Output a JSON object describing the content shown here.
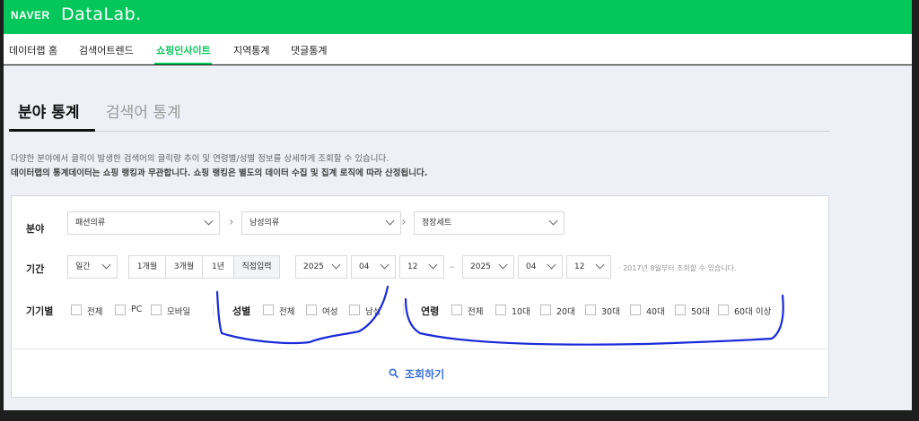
{
  "header": {
    "brand_naver": "NAVER",
    "brand_datalab": "DataLab.",
    "nav": [
      {
        "label": "데이터랩 홈"
      },
      {
        "label": "검색어트렌드"
      },
      {
        "label": "쇼핑인사이트",
        "active": true
      },
      {
        "label": "지역통계"
      },
      {
        "label": "댓글통계"
      }
    ]
  },
  "tabs": {
    "field": "분야 통계",
    "search": "검색어 통계"
  },
  "description": {
    "line1": "다양한 분야에서 클릭이 발생한 검색어의 클릭량 추이 및 연령별/성별 정보를 상세하게 조회할 수 있습니다.",
    "line2": "데이터랩의 통계데이터는 쇼핑 랭킹과 무관합니다. 쇼핑 랭킹은 별도의 데이터 수집 및 집계 로직에 따라 산정됩니다."
  },
  "filters": {
    "category": {
      "label": "분야",
      "level1": "패션의류",
      "level2": "남성의류",
      "level3": "정장세트"
    },
    "period": {
      "label": "기간",
      "unit": "일간",
      "quick": [
        "1개월",
        "3개월",
        "1년",
        "직접입력"
      ],
      "selected_quick": "직접입력",
      "start": {
        "year": "2025",
        "month": "04",
        "day": "12"
      },
      "separator": "–",
      "end": {
        "year": "2025",
        "month": "04",
        "day": "12"
      },
      "note": "· 2017년 8월부터 조회할 수 있습니다."
    },
    "device": {
      "label": "기기별",
      "options": [
        "전체",
        "PC",
        "모바일"
      ]
    },
    "gender": {
      "label": "성별",
      "options": [
        "전체",
        "여성",
        "남성"
      ]
    },
    "age": {
      "label": "연령",
      "options": [
        "전체",
        "10대",
        "20대",
        "30대",
        "40대",
        "50대",
        "60대 이상"
      ]
    }
  },
  "search_button": {
    "label": "조회하기",
    "icon": "search-icon"
  },
  "colors": {
    "brand_green": "#03c75a",
    "link_blue": "#3a6fd8",
    "annotation_blue": "#1a2bd8"
  }
}
